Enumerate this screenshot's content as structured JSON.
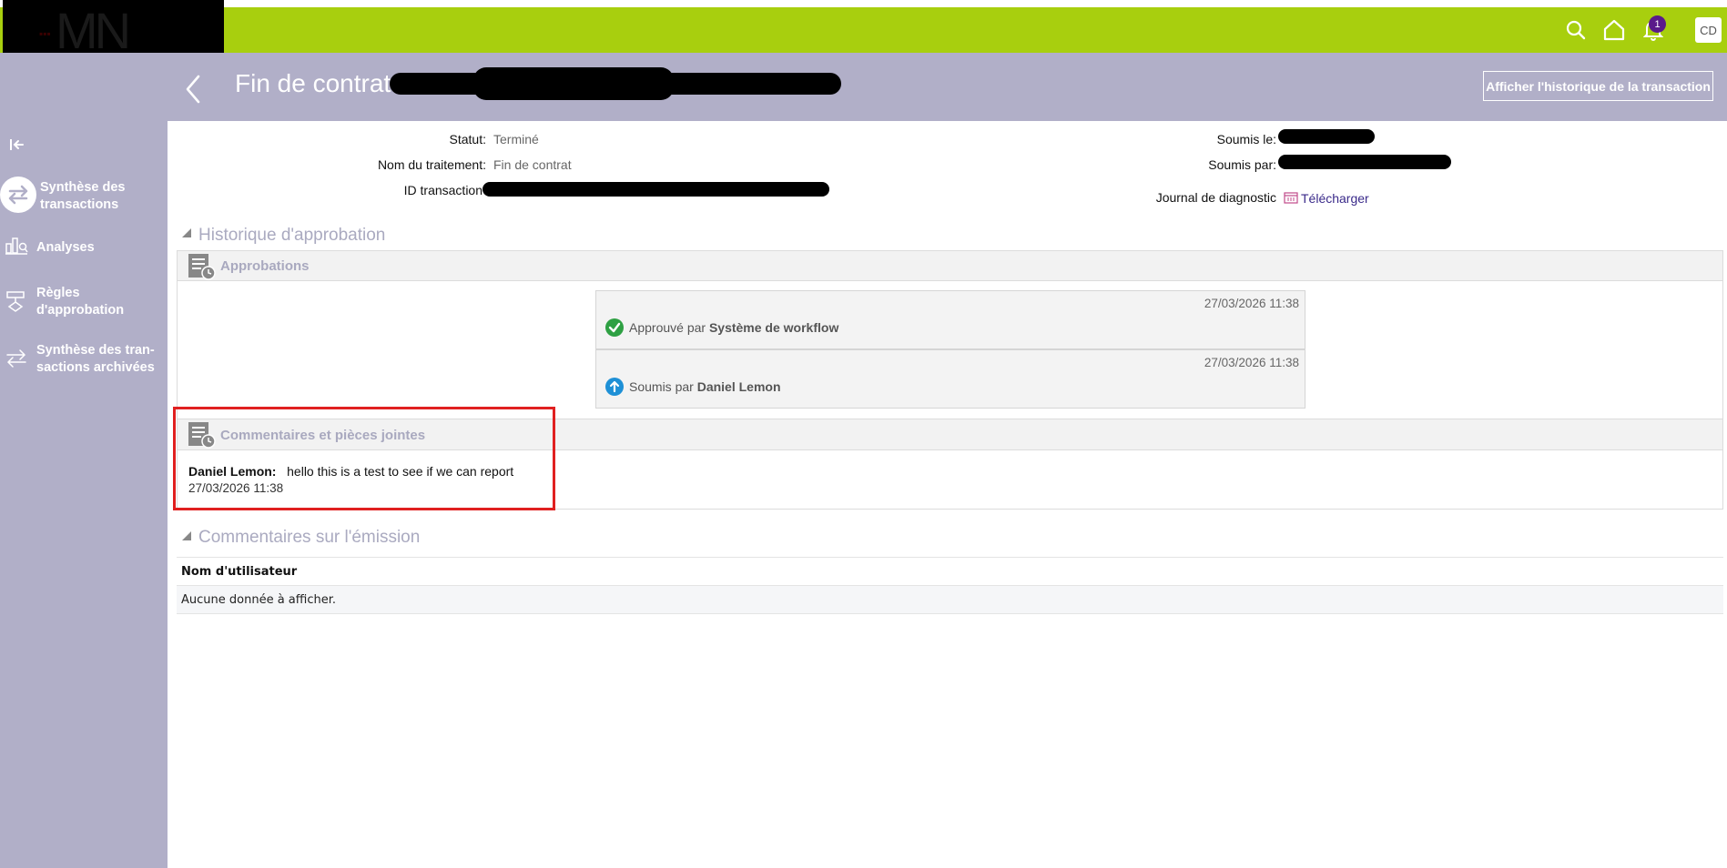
{
  "app": {
    "logo_text": "MN"
  },
  "topbar": {
    "icons": [
      "search-icon",
      "home-icon",
      "bell-icon"
    ],
    "notification_count": "1",
    "avatar_initials": "CD",
    "colors": {
      "bar": "#a8cf0e",
      "badge": "#5a1a8a"
    }
  },
  "sidebar": {
    "items": [
      {
        "label_line1": "Synthèse des",
        "label_line2": "transactions",
        "icon": "transfer-icon",
        "active": true
      },
      {
        "label_line1": "Analyses",
        "label_line2": "",
        "icon": "analytics-icon",
        "active": false
      },
      {
        "label_line1": "Règles",
        "label_line2": "d'approbation",
        "icon": "rules-icon",
        "active": false
      },
      {
        "label_line1": "Synthèse des tran-",
        "label_line2": "sactions archivées",
        "icon": "archive-transfer-icon",
        "active": false
      }
    ],
    "color": "#b1afc8"
  },
  "header": {
    "title": "Fin de contrat",
    "history_button": "Afficher l'historique de la transaction"
  },
  "info": {
    "status_label": "Statut:",
    "status_value": "Terminé",
    "process_label": "Nom du traitement:",
    "process_value": "Fin de contrat",
    "txid_label": "ID transaction",
    "submitted_on_label": "Soumis le:",
    "submitted_by_label": "Soumis par:",
    "diag_label": "Journal de diagnostic",
    "diag_link": "Télécharger"
  },
  "approval_history": {
    "section_title": "Historique d'approbation",
    "panel_title": "Approbations",
    "entries": [
      {
        "date": "27/03/2026 11:38",
        "prefix": "Approuvé par",
        "actor": "Système de workflow",
        "icon": "check-circle-icon",
        "color": "#2ea043"
      },
      {
        "date": "27/03/2026 11:38",
        "prefix": "Soumis par",
        "actor": "Daniel Lemon",
        "icon": "arrow-up-circle-icon",
        "color": "#1e90d6"
      }
    ]
  },
  "comments": {
    "panel_title": "Commentaires et pièces jointes",
    "author": "Daniel Lemon:",
    "text": "hello this is a test to see if we can report",
    "date": "27/03/2026 11:38",
    "highlight_color": "#e02020"
  },
  "emission_comments": {
    "section_title": "Commentaires sur l'émission",
    "column_header": "Nom d'utilisateur",
    "empty_text": "Aucune donnée à afficher."
  }
}
